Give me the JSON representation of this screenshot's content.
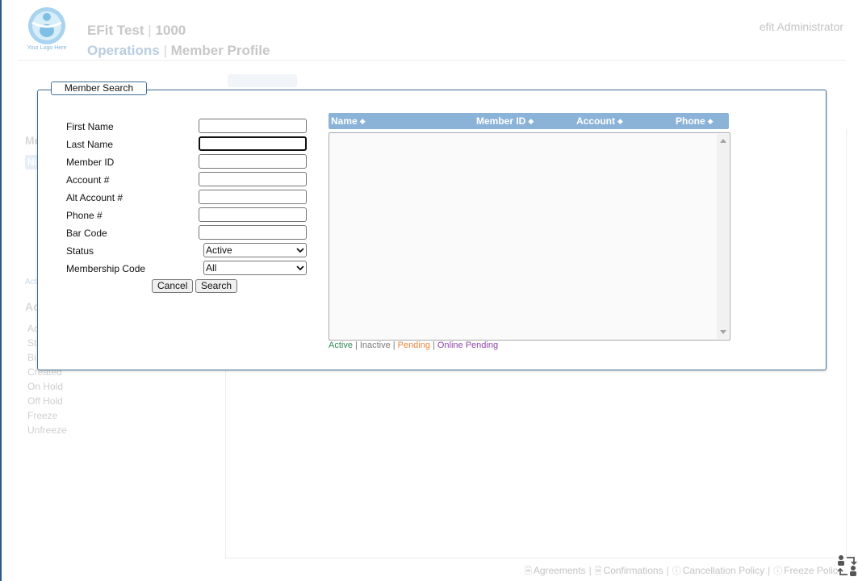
{
  "header": {
    "company": "EFit Test",
    "company_id": "1000",
    "section": "Operations",
    "page": "Member Profile",
    "user": "efit Administrator",
    "logo_text": "Your Logo Here"
  },
  "background": {
    "left_heading_1": "Me",
    "left_chip": "Ni",
    "left_small": "Acti",
    "left_heading_2": "Ac",
    "left_list": [
      "Ac",
      "St",
      "Bi",
      "Created",
      "On Hold",
      "Off Hold",
      "Freeze",
      "Unfreeze"
    ],
    "footer_links": [
      "Agreements",
      "Confirmations",
      "Cancellation Policy",
      "Freeze Polic"
    ]
  },
  "modal": {
    "title": "Member Search",
    "fields": {
      "first_name": {
        "label": "First Name",
        "value": ""
      },
      "last_name": {
        "label": "Last Name",
        "value": ""
      },
      "member_id": {
        "label": "Member ID",
        "value": ""
      },
      "account": {
        "label": "Account #",
        "value": ""
      },
      "alt_account": {
        "label": "Alt Account #",
        "value": ""
      },
      "phone": {
        "label": "Phone #",
        "value": ""
      },
      "bar_code": {
        "label": "Bar Code",
        "value": ""
      },
      "status": {
        "label": "Status",
        "selected": "Active"
      },
      "membership_code": {
        "label": "Membership Code",
        "selected": "All"
      }
    },
    "buttons": {
      "cancel": "Cancel",
      "search": "Search"
    },
    "results": {
      "columns": [
        "Name",
        "Member ID",
        "Account",
        "Phone"
      ],
      "rows": []
    },
    "status_legend": {
      "active": "Active",
      "inactive": "Inactive",
      "pending": "Pending",
      "online_pending": "Online Pending",
      "separator": "|"
    },
    "colors": {
      "active": "#2e8b57",
      "inactive": "#7a7a7a",
      "pending": "#e8873a",
      "online_pending": "#8e44ad",
      "header_bg": "#8bb3d8",
      "border": "#3e6e97"
    }
  }
}
